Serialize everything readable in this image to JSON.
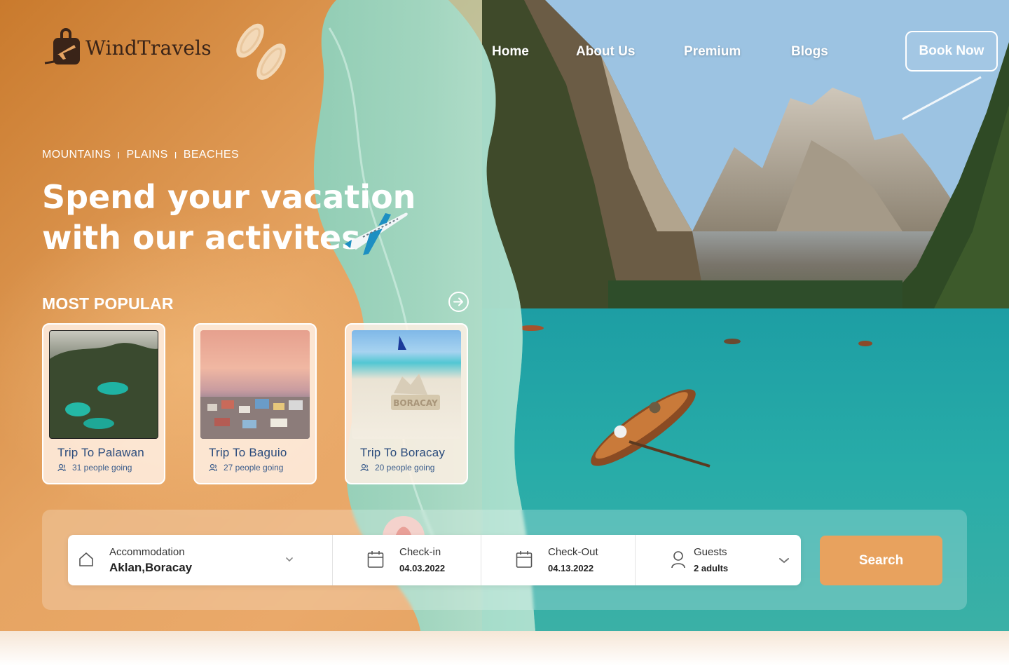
{
  "brand": {
    "name": "WindTravels"
  },
  "nav": {
    "items": [
      "Home",
      "About Us",
      "Premium",
      "Blogs"
    ],
    "cta": "Book Now"
  },
  "hero": {
    "categories": [
      "MOUNTAINS",
      "PLAINS",
      "BEACHES"
    ],
    "separator": "I",
    "headline_line1": "Spend your vacation",
    "headline_line2": "with our activites"
  },
  "popular": {
    "title": "MOST POPULAR",
    "cards": [
      {
        "title": "Trip To Palawan",
        "meta": "31 people going"
      },
      {
        "title": "Trip To Baguio",
        "meta": "27 people going"
      },
      {
        "title": "Trip To Boracay",
        "meta": "20 people going"
      }
    ]
  },
  "search": {
    "accommodation_label": "Accommodation",
    "accommodation_value": "Aklan,Boracay",
    "checkin_label": "Check-in",
    "checkin_value": "04.03.2022",
    "checkout_label": "Check-Out",
    "checkout_value": "04.13.2022",
    "guests_label": "Guests",
    "guests_value": "2 adults",
    "button": "Search"
  },
  "colors": {
    "sand": "#e6a462",
    "accent": "#e8a25e",
    "card_text": "#2a4b7c",
    "logo_text": "#3a2418"
  }
}
